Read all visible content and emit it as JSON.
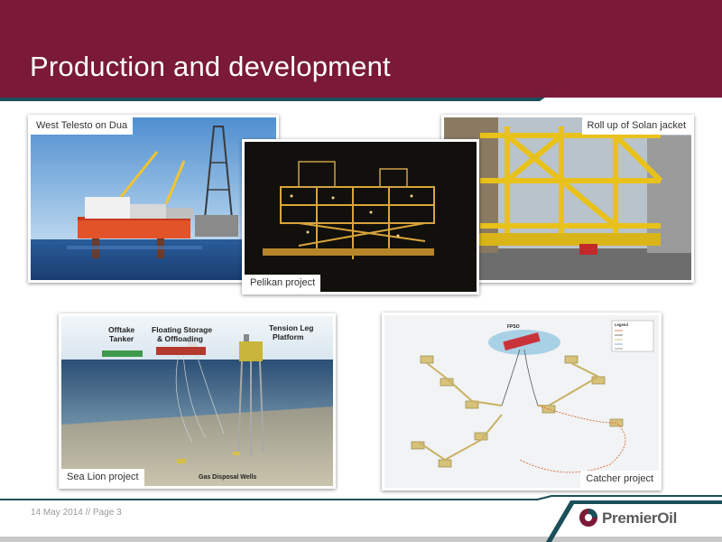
{
  "slide": {
    "title": "Production and development",
    "footer": "14 May 2014 // Page 3",
    "logo_text": "PremierOil"
  },
  "photos": {
    "west_telesto": {
      "caption": "West Telesto on Dua"
    },
    "pelikan": {
      "caption": "Pelikan project"
    },
    "solan": {
      "caption": "Roll up of Solan jacket"
    },
    "sea_lion": {
      "caption": "Sea Lion project",
      "labels": {
        "offtake_1": "Offtake",
        "offtake_2": "Tanker",
        "fso_1": "Floating Storage",
        "fso_2": "& Offloading",
        "tlp_1": "Tension Leg",
        "tlp_2": "Platform",
        "wells": "Gas Disposal Wells"
      }
    },
    "catcher": {
      "caption": "Catcher project",
      "labels": {
        "fpso": "FPSO",
        "legend": "Legend"
      }
    }
  },
  "colors": {
    "brand_maroon": "#7a1a36",
    "brand_teal": "#1b4f5a",
    "footer_grey": "#c9c9c9"
  }
}
